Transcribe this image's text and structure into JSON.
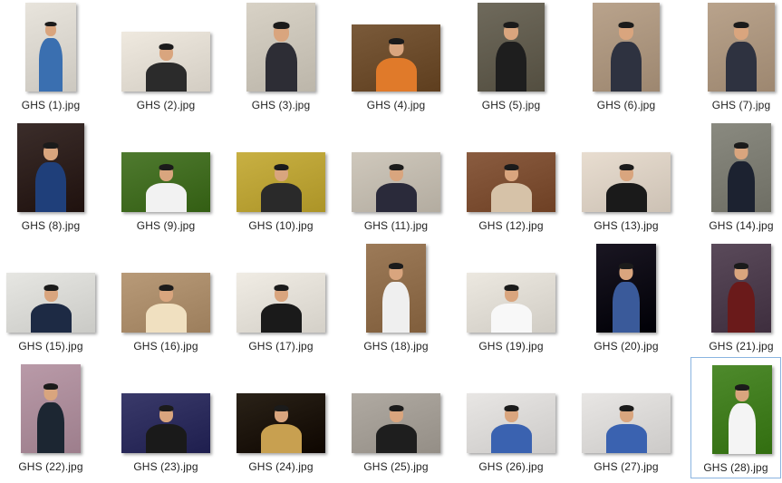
{
  "view": {
    "selected_file": "GHS (28).jpg",
    "selection_color": "#8ab4e0"
  },
  "files": [
    {
      "name": "GHS (1).jpg",
      "icon": "photo-thumbnail",
      "orientation": "portrait",
      "palette": [
        "#e8e4dc",
        "#3a6fb0"
      ]
    },
    {
      "name": "GHS (2).jpg",
      "icon": "photo-thumbnail",
      "orientation": "landscape",
      "palette": [
        "#efe9df",
        "#2b2b2b"
      ]
    },
    {
      "name": "GHS (3).jpg",
      "icon": "photo-thumbnail",
      "orientation": "portrait",
      "palette": [
        "#d8d2c6",
        "#2d2d35"
      ]
    },
    {
      "name": "GHS (4).jpg",
      "icon": "photo-thumbnail",
      "orientation": "landscape",
      "palette": [
        "#7a5a3a",
        "#e07a2a"
      ]
    },
    {
      "name": "GHS (5).jpg",
      "icon": "photo-thumbnail",
      "orientation": "portrait",
      "palette": [
        "#6f6a5c",
        "#1e1e1e"
      ]
    },
    {
      "name": "GHS (6).jpg",
      "icon": "photo-thumbnail",
      "orientation": "portrait",
      "palette": [
        "#b9a38c",
        "#2e3240"
      ]
    },
    {
      "name": "GHS (7).jpg",
      "icon": "photo-thumbnail",
      "orientation": "portrait",
      "palette": [
        "#b9a38c",
        "#2e3240"
      ]
    },
    {
      "name": "GHS (8).jpg",
      "icon": "photo-thumbnail",
      "orientation": "portrait",
      "palette": [
        "#3b2d2a",
        "#1f3f7a"
      ]
    },
    {
      "name": "GHS (9).jpg",
      "icon": "photo-thumbnail",
      "orientation": "landscape",
      "palette": [
        "#4f7a2f",
        "#f2f2f2"
      ]
    },
    {
      "name": "GHS (10).jpg",
      "icon": "photo-thumbnail",
      "orientation": "landscape",
      "palette": [
        "#c8b043",
        "#2a2a2a"
      ]
    },
    {
      "name": "GHS (11).jpg",
      "icon": "photo-thumbnail",
      "orientation": "landscape",
      "palette": [
        "#cfc8bc",
        "#2a2a3a"
      ]
    },
    {
      "name": "GHS (12).jpg",
      "icon": "photo-thumbnail",
      "orientation": "landscape",
      "palette": [
        "#8a5c40",
        "#d6c2a8"
      ]
    },
    {
      "name": "GHS (13).jpg",
      "icon": "photo-thumbnail",
      "orientation": "landscape",
      "palette": [
        "#e8ddd0",
        "#1a1a1a"
      ]
    },
    {
      "name": "GHS (14).jpg",
      "icon": "photo-thumbnail",
      "orientation": "portrait",
      "palette": [
        "#8a8a80",
        "#1c2230"
      ]
    },
    {
      "name": "GHS (15).jpg",
      "icon": "photo-thumbnail",
      "orientation": "landscape",
      "palette": [
        "#e6e6e2",
        "#1d2a44"
      ]
    },
    {
      "name": "GHS (16).jpg",
      "icon": "photo-thumbnail",
      "orientation": "landscape",
      "palette": [
        "#b89a78",
        "#f0e0c0"
      ]
    },
    {
      "name": "GHS (17).jpg",
      "icon": "photo-thumbnail",
      "orientation": "landscape",
      "palette": [
        "#f0ece4",
        "#1a1a1a"
      ]
    },
    {
      "name": "GHS (18).jpg",
      "icon": "photo-thumbnail",
      "orientation": "portrait",
      "palette": [
        "#9c7a58",
        "#efefef"
      ]
    },
    {
      "name": "GHS (19).jpg",
      "icon": "photo-thumbnail",
      "orientation": "landscape",
      "palette": [
        "#ece8e0",
        "#f8f8f8"
      ]
    },
    {
      "name": "GHS (20).jpg",
      "icon": "photo-thumbnail",
      "orientation": "portrait",
      "palette": [
        "#1a1622",
        "#3a5a9a"
      ]
    },
    {
      "name": "GHS (21).jpg",
      "icon": "photo-thumbnail",
      "orientation": "portrait",
      "palette": [
        "#5a4a5a",
        "#6a1a1a"
      ]
    },
    {
      "name": "GHS (22).jpg",
      "icon": "photo-thumbnail",
      "orientation": "portrait",
      "palette": [
        "#b99aa8",
        "#1c2632"
      ]
    },
    {
      "name": "GHS (23).jpg",
      "icon": "photo-thumbnail",
      "orientation": "landscape",
      "palette": [
        "#3a3a6a",
        "#1a1a1a"
      ]
    },
    {
      "name": "GHS (24).jpg",
      "icon": "photo-thumbnail",
      "orientation": "landscape",
      "palette": [
        "#2a2218",
        "#c8a050"
      ]
    },
    {
      "name": "GHS (25).jpg",
      "icon": "photo-thumbnail",
      "orientation": "landscape",
      "palette": [
        "#b0aaa2",
        "#1e1e1e"
      ]
    },
    {
      "name": "GHS (26).jpg",
      "icon": "photo-thumbnail",
      "orientation": "landscape",
      "palette": [
        "#e8e6e4",
        "#3a62b0"
      ]
    },
    {
      "name": "GHS (27).jpg",
      "icon": "photo-thumbnail",
      "orientation": "landscape",
      "palette": [
        "#e8e6e4",
        "#3a62b0"
      ]
    },
    {
      "name": "GHS (28).jpg",
      "icon": "photo-thumbnail",
      "orientation": "portrait",
      "palette": [
        "#4e8a2c",
        "#f4f4f4"
      ]
    }
  ]
}
